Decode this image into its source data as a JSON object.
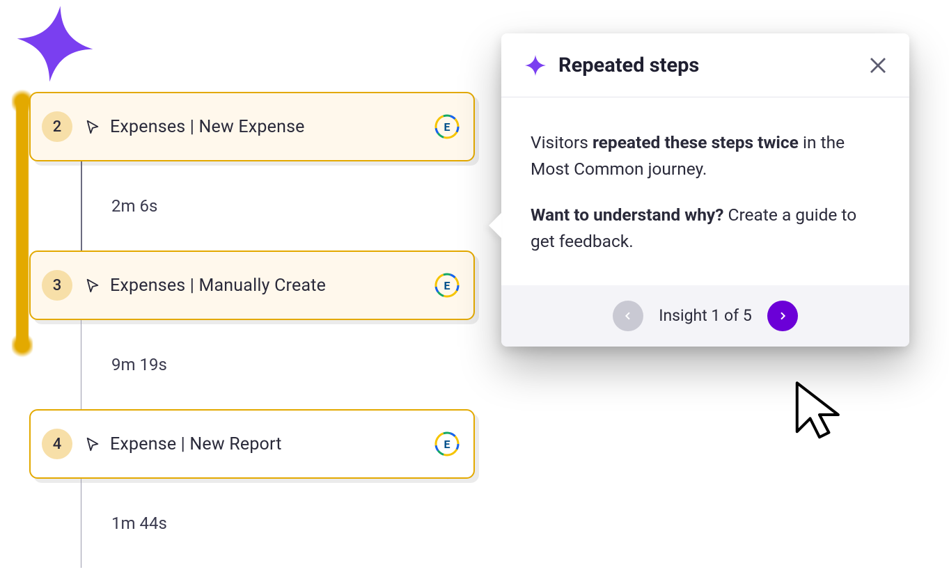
{
  "colors": {
    "accent_purple": "#7A3FF0",
    "accent_yellow": "#E3A900",
    "button_purple": "#6B00D7"
  },
  "timeline": {
    "steps": [
      {
        "num": "2",
        "label": "Expenses | New Expense",
        "highlighted": true
      },
      {
        "num": "3",
        "label": "Expenses | Manually Create",
        "highlighted": true
      },
      {
        "num": "4",
        "label": "Expense | New Report",
        "highlighted": false
      }
    ],
    "gaps": [
      {
        "duration": "2m 6s"
      },
      {
        "duration": "9m 19s"
      },
      {
        "duration": "1m 44s"
      }
    ],
    "app_badge_letter": "E"
  },
  "popover": {
    "title": "Repeated steps",
    "body": {
      "line1_prefix": "Visitors ",
      "line1_bold": "repeated these steps twice",
      "line1_suffix": " in the Most Common journey.",
      "line2_bold": "Want to understand why?",
      "line2_rest": " Create a guide to get feedback."
    },
    "footer": {
      "counter": "Insight 1 of 5"
    }
  }
}
